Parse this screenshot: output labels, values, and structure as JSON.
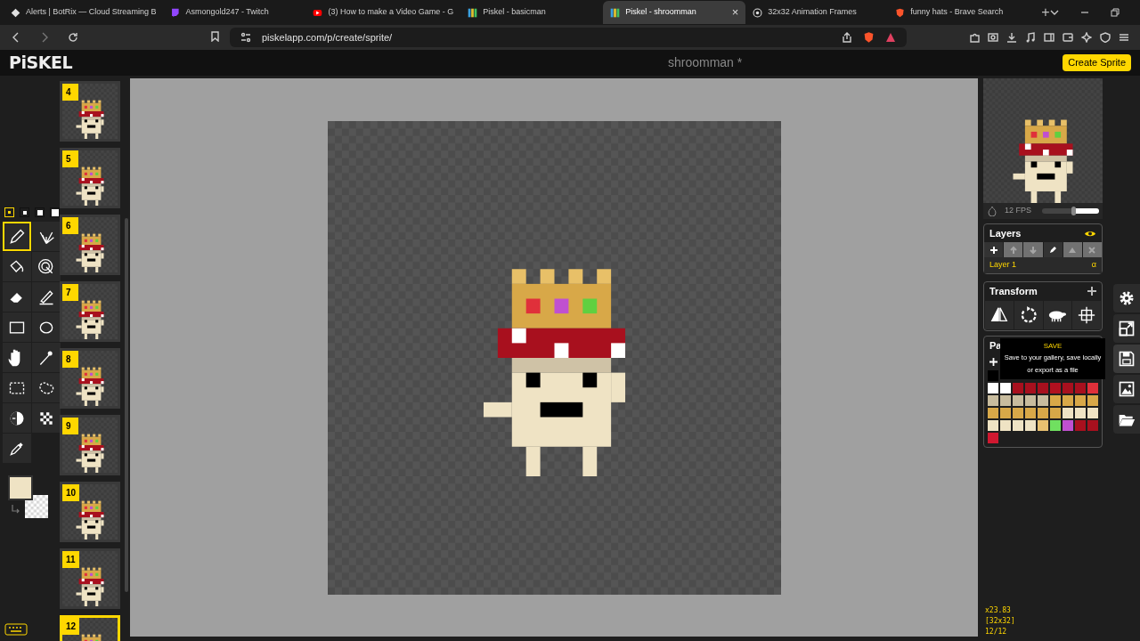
{
  "browser": {
    "tabs": [
      {
        "title": "Alerts | BotRix — Cloud Streaming B",
        "kind": "botrix",
        "selected": false
      },
      {
        "title": "Asmongold247 - Twitch",
        "kind": "twitch",
        "selected": false
      },
      {
        "title": "(3) How to make a Video Game - G",
        "kind": "youtube",
        "selected": false
      },
      {
        "title": "Piskel - basicman",
        "kind": "piskel",
        "selected": false
      },
      {
        "title": "Piskel - shroomman",
        "kind": "piskel",
        "selected": true,
        "close": "×"
      },
      {
        "title": "32x32 Animation Frames",
        "kind": "globe",
        "selected": false
      },
      {
        "title": "funny hats - Brave Search",
        "kind": "brave",
        "selected": false
      }
    ],
    "new_tab": "+",
    "address": "piskelapp.com/p/create/sprite/"
  },
  "app": {
    "logo": "PiSKEL",
    "document_title": "shroomman *",
    "create_button": "Create Sprite"
  },
  "pen_sizes": [
    {
      "selected": true
    },
    {
      "selected": false
    },
    {
      "selected": false
    },
    {
      "selected": false
    }
  ],
  "tools": [
    {
      "kind": "pen",
      "selected": true
    },
    {
      "kind": "mirror",
      "selected": false
    },
    {
      "kind": "bucket",
      "selected": false
    },
    {
      "kind": "samecolor",
      "selected": false
    },
    {
      "kind": "eraser",
      "selected": false
    },
    {
      "kind": "stroke",
      "selected": false
    },
    {
      "kind": "rect",
      "selected": false
    },
    {
      "kind": "circle",
      "selected": false
    },
    {
      "kind": "move",
      "selected": false
    },
    {
      "kind": "wand",
      "selected": false
    },
    {
      "kind": "rectselect",
      "selected": false
    },
    {
      "kind": "lasso",
      "selected": false
    },
    {
      "kind": "lighten",
      "selected": false
    },
    {
      "kind": "dither",
      "selected": false
    },
    {
      "kind": "picker",
      "selected": false
    }
  ],
  "primary_color": {
    "color": "#efe3c4"
  },
  "frames": [
    {
      "number": "4",
      "selected": false
    },
    {
      "number": "5",
      "selected": false
    },
    {
      "number": "6",
      "selected": false
    },
    {
      "number": "7",
      "selected": false
    },
    {
      "number": "8",
      "selected": false
    },
    {
      "number": "9",
      "selected": false
    },
    {
      "number": "10",
      "selected": false
    },
    {
      "number": "11",
      "selected": false
    },
    {
      "number": "12",
      "selected": true
    }
  ],
  "preview": {
    "fps": "12 FPS",
    "level": 0.55
  },
  "layers": {
    "title": "Layers",
    "buttons": [
      {
        "kind": "add",
        "disabled": false
      },
      {
        "kind": "up",
        "disabled": true
      },
      {
        "kind": "down",
        "disabled": true
      },
      {
        "kind": "edit",
        "disabled": false
      },
      {
        "kind": "merge",
        "disabled": true
      },
      {
        "kind": "delete",
        "disabled": true
      }
    ],
    "items": [
      {
        "name": "Layer 1",
        "opacity": "α",
        "selected": true
      }
    ]
  },
  "transform": {
    "title": "Transform",
    "tools": [
      {
        "kind": "flip"
      },
      {
        "kind": "rotate"
      },
      {
        "kind": "clone"
      },
      {
        "kind": "center"
      }
    ]
  },
  "palettes": {
    "title": "Pa",
    "rows": [
      {
        "swatches": [
          {
            "color": "#000000"
          }
        ]
      },
      {
        "swatches": [
          {
            "color": "#ffffff"
          },
          {
            "color": "#ffffff"
          },
          {
            "color": "#a8101e"
          },
          {
            "color": "#a8101e"
          },
          {
            "color": "#a8101e"
          },
          {
            "color": "#b0101f"
          },
          {
            "color": "#a8101e"
          },
          {
            "color": "#a8101e"
          },
          {
            "color": "#e0303a"
          }
        ]
      },
      {
        "swatches": [
          {
            "color": "#c8bc9e"
          },
          {
            "color": "#c8bc9e"
          },
          {
            "color": "#c8bc9e"
          },
          {
            "color": "#c8bc9e"
          },
          {
            "color": "#c8bc9e"
          },
          {
            "color": "#d8a848"
          },
          {
            "color": "#d8a848"
          },
          {
            "color": "#d8a848"
          },
          {
            "color": "#d8a848"
          }
        ]
      },
      {
        "swatches": [
          {
            "color": "#d8a848"
          },
          {
            "color": "#d8a848"
          },
          {
            "color": "#d8a848"
          },
          {
            "color": "#d8a848"
          },
          {
            "color": "#d8a848"
          },
          {
            "color": "#d8a848"
          },
          {
            "color": "#efe3c4"
          },
          {
            "color": "#efe3c4"
          },
          {
            "color": "#efe3c4"
          }
        ]
      },
      {
        "swatches": [
          {
            "color": "#efe3c4"
          },
          {
            "color": "#efe3c4"
          },
          {
            "color": "#efe3c4"
          },
          {
            "color": "#efe3c4"
          },
          {
            "color": "#e8c070"
          },
          {
            "color": "#70e060"
          },
          {
            "color": "#c050d0"
          },
          {
            "color": "#a8101e"
          },
          {
            "color": "#a8101e"
          }
        ]
      },
      {
        "swatches": [
          {
            "color": "#d01830"
          }
        ]
      }
    ]
  },
  "tooltip": {
    "title": "SAVE",
    "text": "Save to your gallery, save locally or export as a file"
  },
  "side_tools": [
    {
      "kind": "settings",
      "hovered": false
    },
    {
      "kind": "resize",
      "hovered": false
    },
    {
      "kind": "save",
      "hovered": true
    },
    {
      "kind": "export",
      "hovered": false
    },
    {
      "kind": "open",
      "hovered": false
    }
  ],
  "status": {
    "zoom": "x23.83",
    "size": "[32x32]",
    "frame": "12/12"
  }
}
